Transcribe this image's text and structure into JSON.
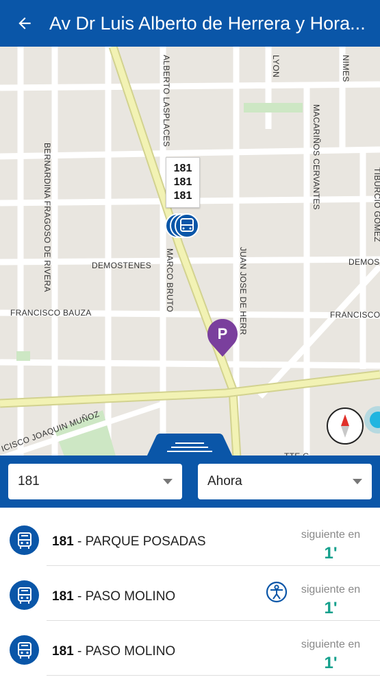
{
  "header": {
    "title": "Av Dr Luis Alberto de Herrera y Hora..."
  },
  "map": {
    "streets": {
      "lasplaces": "ALBERTO LASPLACES",
      "lyon": "LYON",
      "nimes": "NIMES",
      "macarinos": "MACARIÑOS CERVANTES",
      "tiburcio": "TIBURCIO GOMEZ",
      "bernardina": "BERNARDINA FRAGOSO DE RIVERA",
      "demostenes1": "DEMOSTENES",
      "demostenes2": "DEMOS",
      "marco": "MARCO BRUTO",
      "juan": "JUAN JOSE DE HERR",
      "bauza": "FRANCISCO BAUZA",
      "francisco2": "FRANCISCO",
      "munoz": "ICISCO JOAQUIN MUÑOZ",
      "tte": "TTE G"
    },
    "stop_lines": [
      "181",
      "181",
      "181"
    ],
    "parking_label": "P"
  },
  "filters": {
    "line_value": "181",
    "time_value": "Ahora"
  },
  "arrivals": [
    {
      "line": "181",
      "destination": " - PARQUE POSADAS",
      "next_label": "siguiente en",
      "minutes": "1'",
      "accessible": false
    },
    {
      "line": "181",
      "destination": " - PASO MOLINO",
      "next_label": "siguiente en",
      "minutes": "1'",
      "accessible": true
    },
    {
      "line": "181",
      "destination": " - PASO MOLINO",
      "next_label": "siguiente en",
      "minutes": "1'",
      "accessible": false
    }
  ],
  "colors": {
    "primary": "#0a56a8",
    "accent": "#14a08c",
    "parking": "#7a3f9d"
  }
}
